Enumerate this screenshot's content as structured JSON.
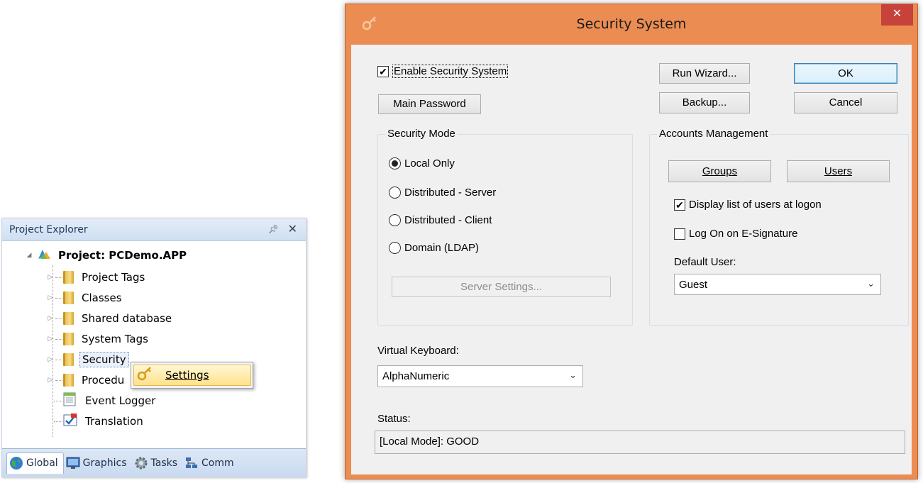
{
  "explorer": {
    "title": "Project Explorer",
    "pin_glyph": "⌂",
    "close_glyph": "✕",
    "root": {
      "label": "Project: PCDemo.APP",
      "icon": "project-icon"
    },
    "items": [
      {
        "label": "Project Tags",
        "icon": "folder-icon"
      },
      {
        "label": "Classes",
        "icon": "folder-icon"
      },
      {
        "label": "Shared database",
        "icon": "folder-icon"
      },
      {
        "label": "System Tags",
        "icon": "folder-icon"
      },
      {
        "label": "Security",
        "icon": "folder-icon"
      },
      {
        "label": "Procedu",
        "icon": "folder-icon"
      },
      {
        "label": "Event Logger",
        "icon": "event-logger-icon"
      },
      {
        "label": "Translation",
        "icon": "translation-icon"
      }
    ],
    "context_menu": {
      "label": "Settings",
      "icon": "key-icon"
    },
    "tabs": [
      {
        "label": "Global",
        "icon": "globe-icon"
      },
      {
        "label": "Graphics",
        "icon": "monitor-icon"
      },
      {
        "label": "Tasks",
        "icon": "gear-icon"
      },
      {
        "label": "Comm",
        "icon": "network-icon"
      }
    ]
  },
  "dialog": {
    "title": "Security System",
    "close_glyph": "✕",
    "accent_color": "#eb8d52",
    "enable_security": {
      "label": "Enable Security System",
      "checked": true
    },
    "main_password": "Main Password",
    "run_wizard": "Run Wizard...",
    "ok": "OK",
    "backup": "Backup...",
    "cancel": "Cancel",
    "security_mode": {
      "title": "Security Mode",
      "options": [
        "Local Only",
        "Distributed - Server",
        "Distributed - Client",
        "Domain (LDAP)"
      ],
      "selected": "Local Only",
      "server_settings": "Server Settings..."
    },
    "accounts": {
      "title": "Accounts Management",
      "groups": "Groups",
      "users": "Users",
      "display_list": {
        "label": "Display list of users at logon",
        "checked": true
      },
      "log_on_esig": {
        "label": "Log On on E-Signature",
        "checked": false
      },
      "default_user_label": "Default User:",
      "default_user_value": "Guest"
    },
    "virtual_keyboard": {
      "label": "Virtual Keyboard:",
      "value": "AlphaNumeric"
    },
    "status": {
      "label": "Status:",
      "value": "[Local Mode]: GOOD"
    }
  }
}
